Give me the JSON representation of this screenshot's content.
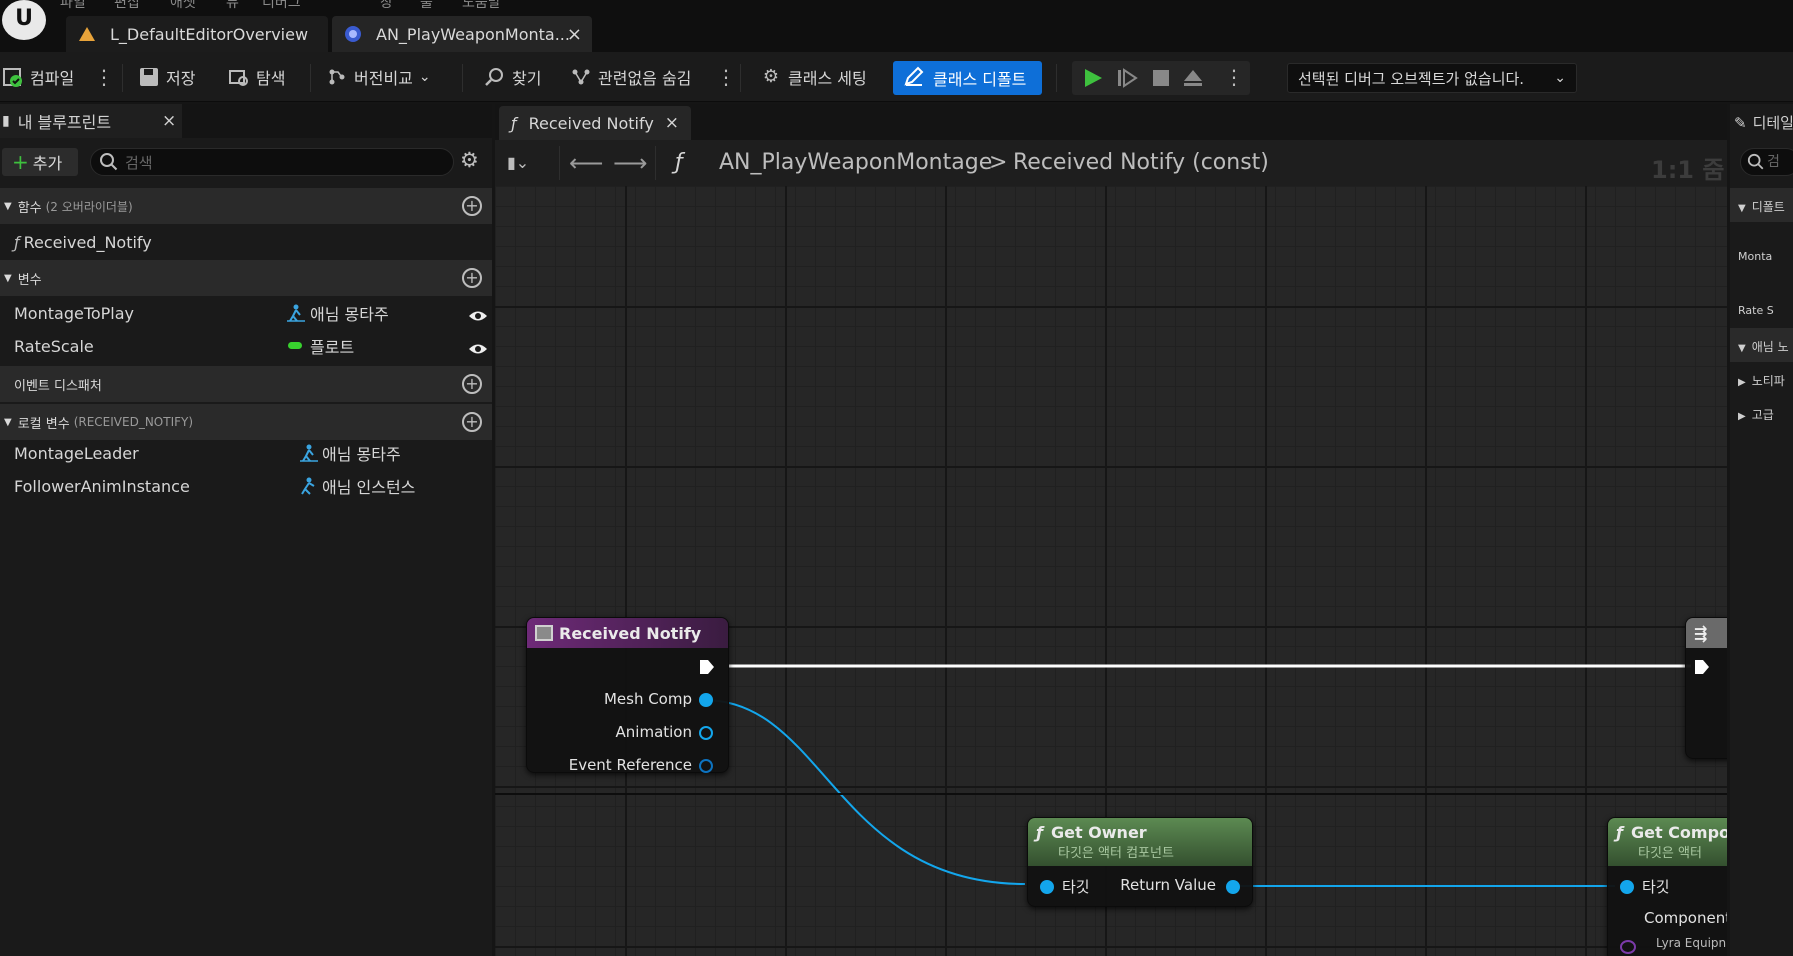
{
  "menu": {
    "items": [
      "파일",
      "편집",
      "애셋",
      "뷰",
      "디버그",
      "창",
      "툴",
      "도움말"
    ]
  },
  "tabs": [
    {
      "label": "L_DefaultEditorOverview",
      "icon": "level-icon"
    },
    {
      "label": "AN_PlayWeaponMonta...",
      "icon": "blueprint-icon",
      "close": "×"
    }
  ],
  "toolbar": {
    "compile": "컴파일",
    "save": "저장",
    "browse": "탐색",
    "diff": "버전비교",
    "find": "찾기",
    "hide_unrelated": "관련없음 숨김",
    "class_settings": "클래스 세팅",
    "class_defaults": "클래스 디폴트",
    "debug_object": "선택된 디버그 오브젝트가 없습니다."
  },
  "left_panel": {
    "tab_title": "내 블루프린트",
    "close": "×",
    "add_label": "추가",
    "search_placeholder": "검색",
    "functions": {
      "title": "함수",
      "sub": "(2 오버라이더블)",
      "items": [
        "Received_Notify"
      ]
    },
    "variables": {
      "title": "변수",
      "items": [
        {
          "name": "MontageToPlay",
          "type": "애님 몽타주",
          "type_color": "#3aa4e0"
        },
        {
          "name": "RateScale",
          "type": "플로트",
          "type_color": "#38d12e"
        }
      ]
    },
    "event_dispatchers": {
      "title": "이벤트 디스패처"
    },
    "local_variables": {
      "title": "로컬 변수",
      "sub": "(RECEIVED_NOTIFY)",
      "items": [
        {
          "name": "MontageLeader",
          "type": "애님 몽타주"
        },
        {
          "name": "FollowerAnimInstance",
          "type": "애님 인스턴스"
        }
      ]
    }
  },
  "graph": {
    "tab_label": "Received Notify",
    "tab_close": "×",
    "breadcrumb": {
      "asset": "AN_PlayWeaponMontage",
      "separator": ">",
      "function": "Received Notify (const)"
    },
    "zoom": "1:1 줌",
    "nodes": {
      "received_notify": {
        "title": "Received Notify",
        "header_color": "#6e2a78",
        "pins": [
          "Mesh Comp",
          "Animation",
          "Event Reference"
        ]
      },
      "get_owner": {
        "title": "Get Owner",
        "subtitle": "타깃은 액터 컴포넌트",
        "header_color": "#4f7a45",
        "input_pin": "타깃",
        "output_pin": "Return Value"
      },
      "get_component": {
        "title": "Get Compo",
        "subtitle": "타깃은 액터",
        "input_pin": "타깃",
        "pin2": "Component",
        "pin2_sub": "Lyra Equipn"
      }
    }
  },
  "right_panel": {
    "tab_title": "디테일",
    "search": "검",
    "rows": [
      "디폴트",
      "Monta",
      "Rate S",
      "애님 노",
      "노티파",
      "고급"
    ]
  },
  "colors": {
    "accent": "#0e6fd8",
    "exec_wire": "#ffffff",
    "object_wire": "#13a6ec",
    "play_green": "#3ec13e"
  }
}
